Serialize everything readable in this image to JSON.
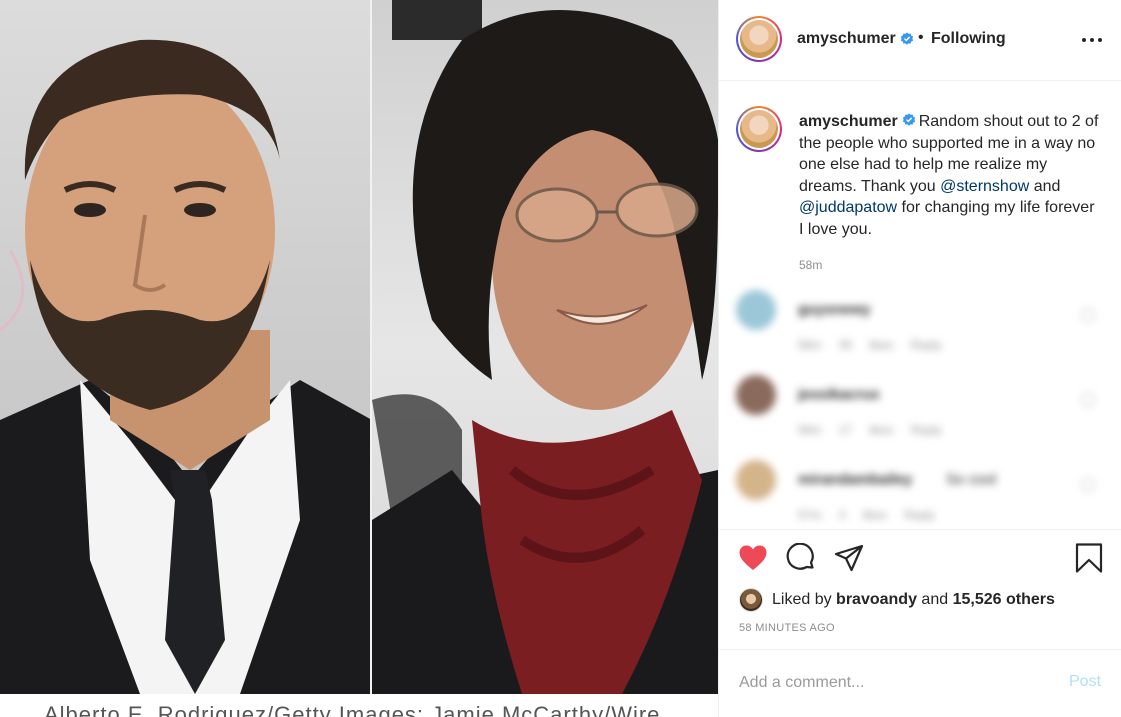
{
  "post": {
    "username": "amyschumer",
    "separator": "•",
    "follow_status": "Following",
    "caption_lines": {
      "part1": "Random shout out to 2 of the people who supported me in a way no one else had to help me realize my dreams. Thank you ",
      "mention1": "@sternshow",
      "part2": " and ",
      "mention2": "@juddapatow",
      "part3": " for changing my life forever I love you."
    },
    "caption_age": "58m",
    "photo_credit_partial": "Alberto E. Rodriguez/Getty Images; Jamie McCarthy/Wire"
  },
  "comments": [
    {
      "name": "guysnewy",
      "body": "",
      "meta": "56m 35 likes Reply",
      "avatar_color": "#9bc7d8"
    },
    {
      "name": "jessikacrux",
      "body": "",
      "meta": "56m 17 likes Reply",
      "avatar_color": "#8a6a5c"
    },
    {
      "name": "mirandambailey",
      "body": "So cool",
      "meta": "57m 3 likes Reply",
      "avatar_color": "#d4b48a"
    }
  ],
  "likes": {
    "prefix": "Liked by",
    "first_user": "bravoandy",
    "and": "and",
    "others": "15,526 others"
  },
  "timestamp": "58 MINUTES AGO",
  "comment_box": {
    "placeholder": "Add a comment...",
    "post_label": "Post"
  },
  "colors": {
    "verified": "#3897f0",
    "heart": "#ed4956",
    "link": "#00376b",
    "post_disabled": "#b2dffc"
  }
}
